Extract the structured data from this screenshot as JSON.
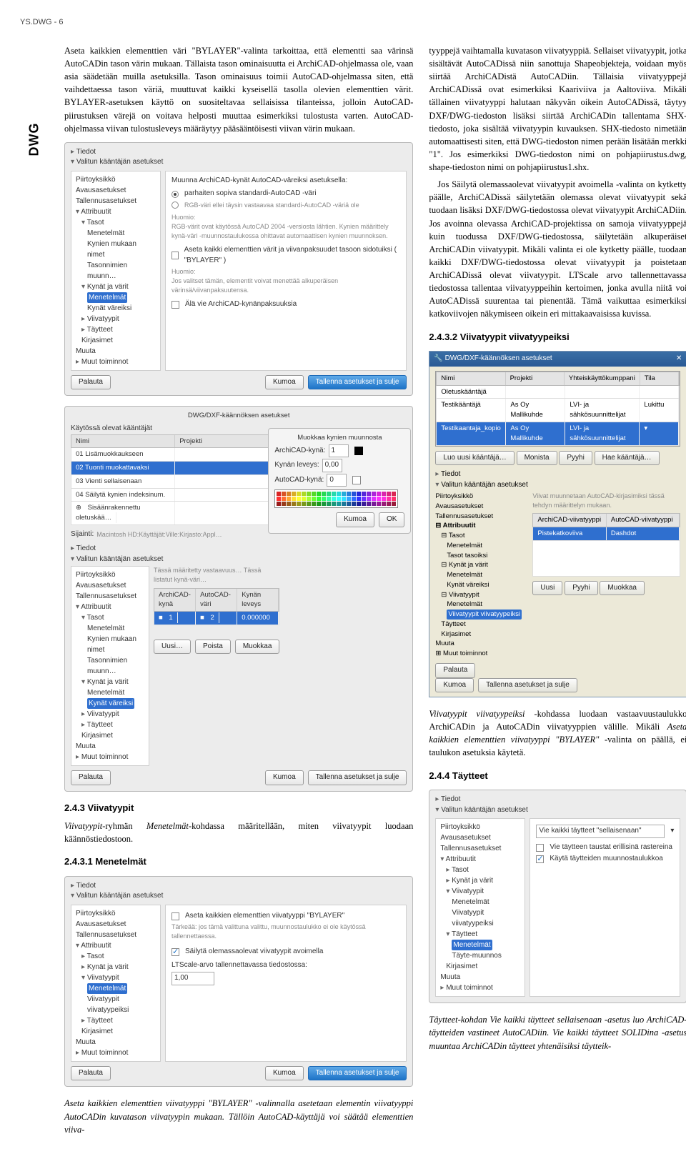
{
  "header": "YS.DWG - 6",
  "dwg_tab": "DWG",
  "left": {
    "p1": "Aseta kaikkien elementtien väri \"BYLAYER\"-valinta tarkoittaa, että elementti saa värinsä AutoCADin tason värin mukaan. Tällaista tason ominaisuutta ei ArchiCAD-ohjelmassa ole, vaan asia säädetään muilla asetuksilla. Tason ominaisuus toimii AutoCAD-ohjelmassa siten, että vaihdettaessa tason väriä, muuttuvat kaikki kyseisellä tasolla olevien elementtien värit. BYLAYER-asetuksen käyttö on suositeltavaa sellaisissa tilanteissa, jolloin AutoCAD-piirustuksen värejä on voitava helposti muuttaa esimerkiksi tulostusta varten. AutoCAD-ohjelmassa viivan tulostusleveys määräytyy pääsääntöisesti viivan värin mukaan.",
    "h243": "2.4.3   Viivatyypit",
    "p243": "Viivatyypit-ryhmän Menetelmät-kohdassa määritellään, miten viivatyypit luodaan käännöstiedostoon.",
    "h2431": "2.4.3.1 Menetelmät",
    "caption3": "Aseta kaikkien elementtien viivatyyppi \"BYLAYER\" -valinnalla asetetaan elementin viivatyyppi AutoCADin kuvatason viivatyypin mukaan. Tällöin AutoCAD-käyttäjä voi säätää elementtien viiva-"
  },
  "right": {
    "p1": "tyyppejä vaihtamalla kuvatason viivatyyppiä. Sellaiset viivatyypit, jotka sisältävät AutoCADissä niin sanottuja Shapeobjekteja, voidaan myös siirtää ArchiCADistä AutoCADiin. Tällaisia viivatyyppejä ArchiCADissä ovat esimerkiksi Kaariviiva ja Aaltoviiva. Mikäli tällainen viivatyyppi halutaan näkyvän oikein AutoCADissä, täytyy DXF/DWG-tiedoston lisäksi siirtää ArchiCADin tallentama SHX-tiedosto, joka sisältää viivatyypin kuvauksen. SHX-tiedosto nimetään automaattisesti siten, että DWG-tiedoston nimen perään lisätään merkki \"1\". Jos esimerkiksi DWG-tiedoston nimi on pohjapiirustus.dwg, shape-tiedoston nimi on pohjapiirustus1.shx.",
    "p2": "Jos Säilytä olemassaolevat viivatyypit avoimella -valinta on kytketty päälle, ArchiCADissä säilytetään olemassa olevat viivatyypit sekä tuodaan lisäksi DXF/DWG-tiedostossa olevat viivatyypit ArchiCADiin. Jos avoinna olevassa ArchiCAD-projektissa on samoja viivatyyppejä kuin tuodussa DXF/DWG-tiedostossa, säilytetään alkuperäiset ArchiCADin viivatyypit. Mikäli valinta ei ole kytketty päälle, tuodaan kaikki DXF/DWG-tiedostossa olevat viivatyypit ja poistetaan ArchiCADissä olevat viivatyypit. LTScale arvo tallennettavassa tiedostossa tallentaa viivatyyppeihin kertoimen, jonka avulla niitä voi AutoCADissä suurentaa tai pienentää. Tämä vaikuttaa esimerkiksi katkoviivojen näkymiseen oikein eri mittakaavaisissa kuvissa.",
    "h2432": "2.4.3.2 Viivatyypit viivatyypeiksi",
    "p2432": "Viivatyypit viivatyypeiksi -kohdassa luodaan vastaavuustaulukko ArchiCADin ja AutoCADin viivatyyppien välille. Mikäli Aseta kaikkien elementtien viivatyyppi \"BYLAYER\" -valinta on päällä, ei taulukon asetuksia käytetä.",
    "h244": "2.4.4   Täytteet",
    "caption4": "Täytteet-kohdan Vie kaikki täytteet sellaisenaan -asetus luo ArchiCAD-täytteiden vastineet AutoCADiin. Vie kaikki täytteet SOLIDina -asetus muuntaa ArchiCADin täytteet yhtenäisiksi täytteik-"
  },
  "shot1": {
    "tiedot": "Tiedot",
    "valitun": "Valitun kääntäjän asetukset",
    "tree": [
      "Piirtoyksikkö",
      "Avausasetukset",
      "Tallennusasetukset",
      "Attribuutit",
      "Tasot",
      "Menetelmät",
      "Kynien mukaan nimet",
      "Tasonnimien muunn…",
      "Kynät ja värit",
      "Menetelmät",
      "Kynät väreiksi",
      "Viivatyypit",
      "Täytteet",
      "Kirjasimet",
      "Muuta",
      "Muut toiminnot"
    ],
    "title": "Muunna ArchiCAD-kynät AutoCAD-väreiksi asetuksella:",
    "opt1": "parhaiten sopiva standardi-AutoCAD -väri",
    "opt2": "RGB-väri ellei täysin vastaavaa standardi-AutoCAD -väriä ole",
    "note1": "Huomio:\nRGB-värit ovat käytössä AutoCAD 2004 -versiosta lähtien. Kynien määrittely kynä-väri -muunnostaulukossa ohittavat automaattisen kynien muunnoksen.",
    "chk1": "Aseta kaikki elementtien värit ja viivanpaksuudet tasoon sidotuiksi ( \"BYLAYER\" )",
    "note2": "Huomio:\nJos valitset tämän, elementit voivat menettää alkuperäisen värinsä/viivanpaksuutensa.",
    "chk2": "Älä vie ArchiCAD-kynänpaksuuksia",
    "palauta": "Palauta",
    "kumoa": "Kumoa",
    "tallenna": "Tallenna asetukset ja sulje"
  },
  "shot2": {
    "title": "DWG/DXF-käännöksen asetukset",
    "popup_title": "Muokkaa kynien muunnosta",
    "k_label": "Käytössä olevat kääntäjät",
    "col1": "Nimi",
    "col2": "Projekti",
    "r1": "01 Lisämuokkaukseen",
    "r2": "02 Tuonti muokattavaksi",
    "r3": "03 Vienti sellaisenaan",
    "r4": "04 Säilytä kynien indeksinum.",
    "r5": "Sisäänrakennettu oletuskää…",
    "sij_label": "Sijainti:",
    "sij_val": "Macintosh HD:Käyttäjät:Ville:Kirjasto:Appl…",
    "tree": [
      "Piirtoyksikkö",
      "Avausasetukset",
      "Tallennusasetukset",
      "Attribuutit",
      "Tasot",
      "Menetelmät",
      "Kynien mukaan nimet",
      "Tasonnimien muunn…",
      "Kynät ja värit",
      "Menetelmät",
      "Kynät väreiksi",
      "Viivatyypit",
      "Täytteet",
      "Kirjasimet",
      "Muuta",
      "Muut toiminnot"
    ],
    "ac_label1": "ArchiCAD-kynä:",
    "ac_val1": "1",
    "kl_label": "Kynän leveys:",
    "kl_val": "0,00",
    "ac_label2": "AutoCAD-kynä:",
    "ac_val2": "0",
    "ok": "OK",
    "note": "Tässä määritetty vastaavuus… Tässä listatut kynä-väri…",
    "head1": "ArchiCAD-kynä",
    "head2": "AutoCAD-väri",
    "head3": "Kynän leveys",
    "row1": "1",
    "row2": "2",
    "row3": "0.000000",
    "uusi": "Uusi…",
    "poista": "Poista",
    "muokkaa": "Muokkaa"
  },
  "shot3": {
    "tree": [
      "Piirtoyksikkö",
      "Avausasetukset",
      "Tallennusasetukset",
      "Attribuutit",
      "Tasot",
      "Kynät ja värit",
      "Viivatyypit",
      "Menetelmät",
      "Viivatyypit viivatyypeiksi",
      "Täytteet",
      "Kirjasimet",
      "Muuta",
      "Muut toiminnot"
    ],
    "chk1": "Aseta kaikkien elementtien viivatyyppi \"BYLAYER\"",
    "note1": "Tärkeää: jos tämä valittuna valittu, muunnostaulukko ei ole käytössä tallennettaessa.",
    "chk2": "Säilytä olemassaolevat viivatyypit avoimella",
    "lts_label": "LTScale-arvo tallennettavassa tiedostossa:",
    "lts_val": "1,00"
  },
  "shot4": {
    "title": "DWG/DXF-käännöksen asetukset",
    "col1": "Nimi",
    "col2": "Projekti",
    "col3": "Yhteiskäyttökumppani",
    "col4": "Tila",
    "r1": "Oletuskääntäjä",
    "r2a": "Testikääntäjä",
    "r2b": "As Oy Mallikuhde",
    "r2c": "LVI- ja sähkösuunnittelijat",
    "r2d": "Lukittu",
    "r3a": "Testikaantaja_kopio",
    "r3b": "As Oy Mallikuhde",
    "r3c": "LVI- ja sähkösuunnittelijat",
    "btn_luo": "Luo uusi kääntäjä…",
    "btn_mon": "Monista",
    "btn_pyy": "Pyyhi",
    "btn_hae": "Hae kääntäjä…",
    "note": "Viivat muunnetaan AutoCAD-kirjasimiksi tässä tehdyn määrittelyn mukaan.",
    "h1": "ArchiCAD-viivatyyppi",
    "h2": "AutoCAD-viivatyyppi",
    "rowa": "Pistekatkoviiva",
    "rowb": "Dashdot",
    "tree": [
      "Piirtoyksikkö",
      "Avausasetukset",
      "Tallennusasetukset",
      "Attribuutit",
      "Tasot",
      "Menetelmät",
      "Tasot tasoiksi",
      "Kynät ja värit",
      "Menetelmät",
      "Kynät väreiksi",
      "Viivatyypit",
      "Menetelmät",
      "Viivatyypit viivatyypeiksi",
      "Täytteet",
      "Kirjasimet",
      "Muuta",
      "Muut toiminnot"
    ],
    "uusi": "Uusi",
    "pyyhi": "Pyyhi",
    "muokkaa": "Muokkaa"
  },
  "shot5": {
    "tree": [
      "Piirtoyksikkö",
      "Avausasetukset",
      "Tallennusasetukset",
      "Attribuutit",
      "Tasot",
      "Kynät ja värit",
      "Viivatyypit",
      "Menetelmät",
      "Viivatyypit viivatyypeiksi",
      "Täytteet",
      "Menetelmät",
      "Täyte-muunnos",
      "Kirjasimet",
      "Muuta",
      "Muut toiminnot"
    ],
    "sel_label": "Vie kaikki täytteet \"sellaisenaan\"",
    "chk1": "Vie täytteen taustat erillisinä rastereina",
    "chk2": "Käytä täytteiden muunnostaulukkoa"
  }
}
